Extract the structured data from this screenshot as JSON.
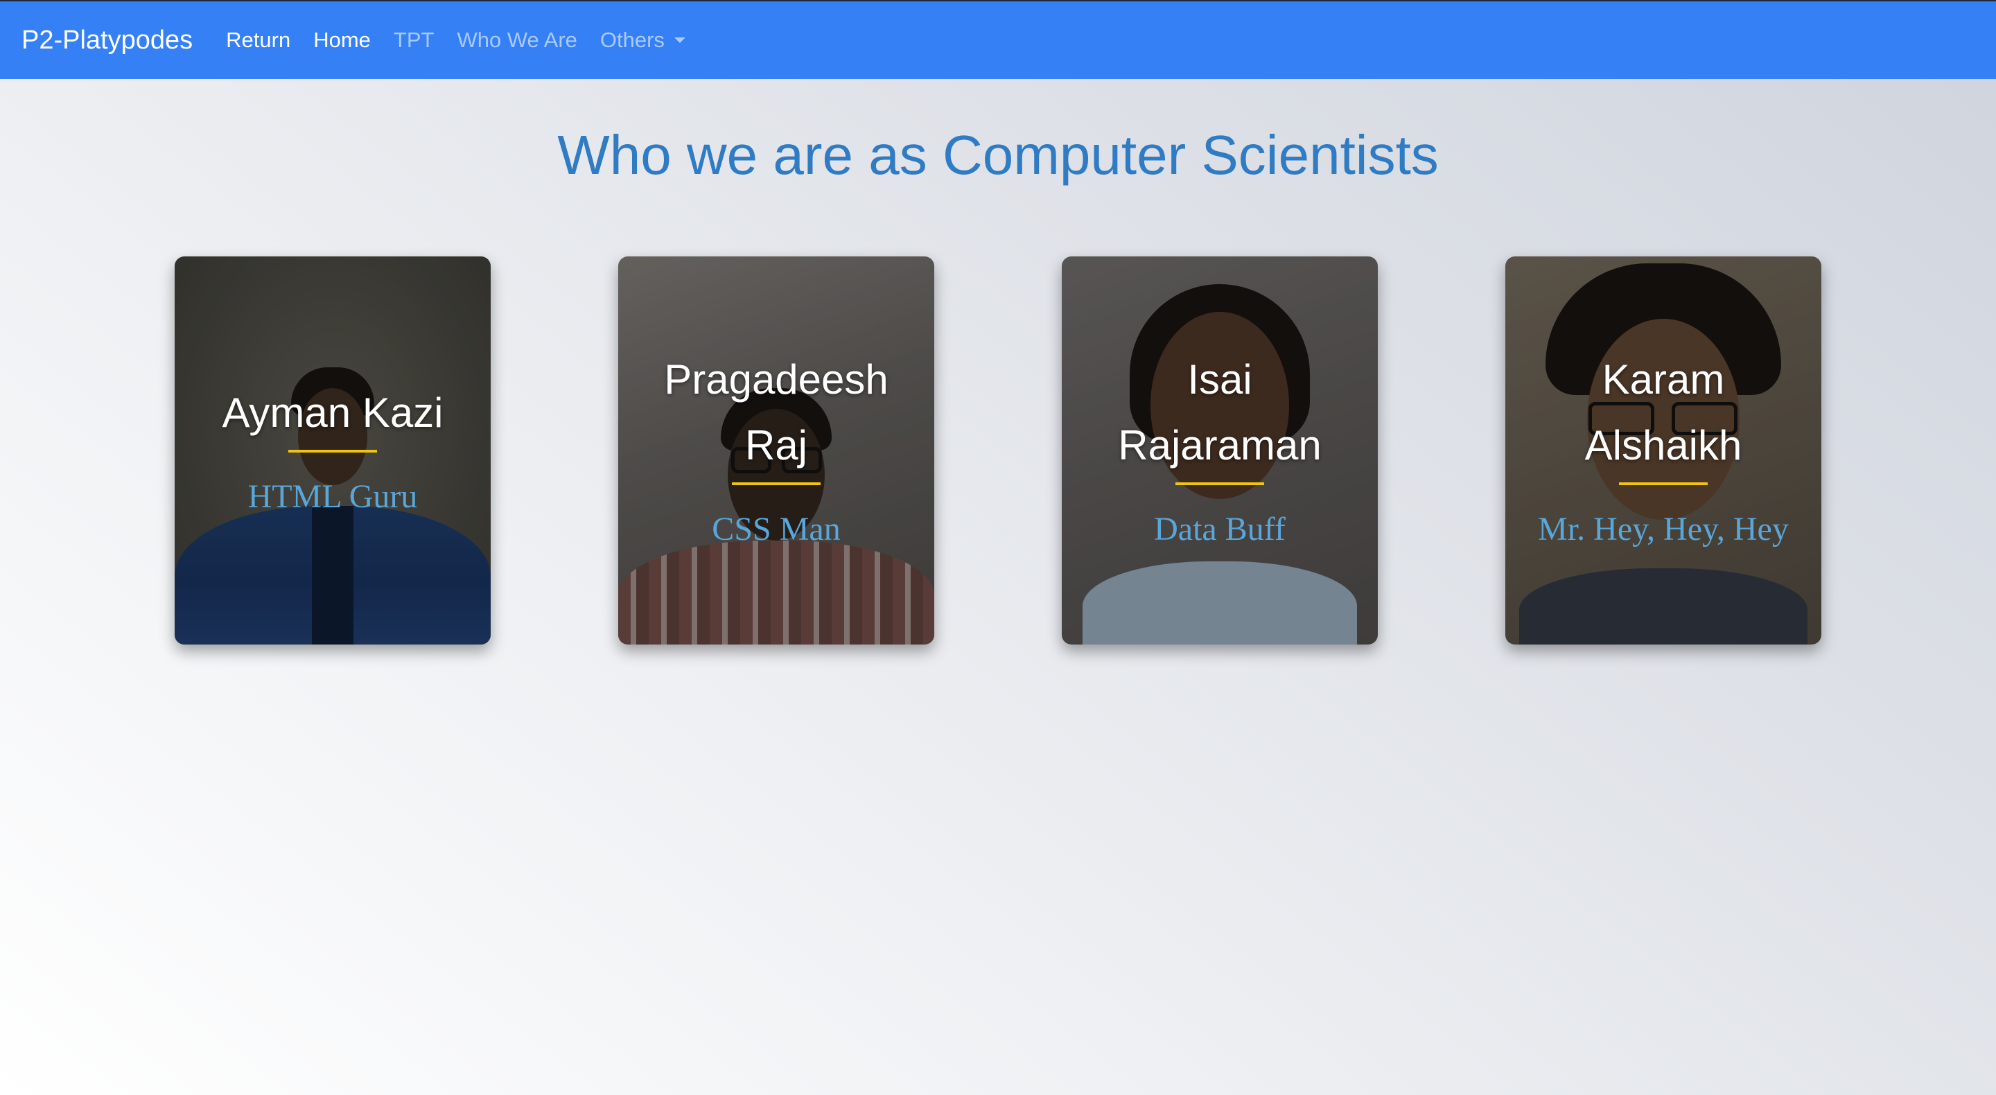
{
  "navbar": {
    "brand": "P2-Platypodes",
    "links": [
      {
        "label": "Return"
      },
      {
        "label": "Home"
      },
      {
        "label": "TPT"
      },
      {
        "label": "Who We Are"
      },
      {
        "label": "Others"
      }
    ]
  },
  "page": {
    "title": "Who we are as Computer Scientists"
  },
  "cards": [
    {
      "name": "Ayman Kazi",
      "role": "HTML Guru"
    },
    {
      "name": "Pragadeesh Raj",
      "role": "CSS Man"
    },
    {
      "name": "Isai Rajaraman",
      "role": "Data Buff"
    },
    {
      "name": "Karam Alshaikh",
      "role": "Mr. Hey, Hey, Hey"
    }
  ],
  "colors": {
    "navbar": "#3580f5",
    "title": "#2f7bc4",
    "role_text": "#5aa6d9",
    "accent_rule": "#f1c40f"
  }
}
